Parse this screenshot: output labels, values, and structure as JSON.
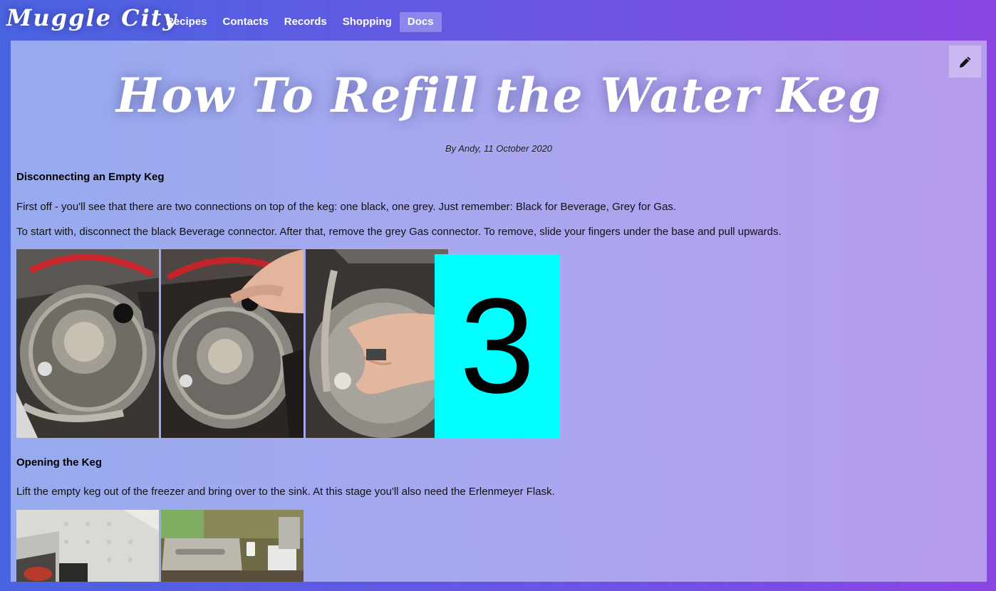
{
  "app": {
    "brand": "Muggle City"
  },
  "nav": {
    "items": [
      {
        "label": "Recipes"
      },
      {
        "label": "Contacts"
      },
      {
        "label": "Records"
      },
      {
        "label": "Shopping"
      },
      {
        "label": "Docs",
        "active": true
      }
    ]
  },
  "toolbar": {
    "edit_icon": "pencil-icon"
  },
  "article": {
    "title": "How To Refill the Water Keg",
    "byline": "By Andy, 11 October 2020",
    "sections": [
      {
        "heading": "Disconnecting an Empty Keg",
        "paragraphs": [
          "First off - you'll see that there are two connections on top of the keg: one black, one grey. Just remember: Black for Beverage, Grey for Gas.",
          "To start with, disconnect the black Beverage connector. After that, remove the grey Gas connector. To remove, slide your fingers under the base and pull upwards."
        ],
        "photos": [
          "keg-top-photo",
          "keg-disconnect-photo",
          "keg-lift-photo"
        ],
        "overlay_number": "3"
      },
      {
        "heading": "Opening the Keg",
        "paragraphs": [
          "Lift the empty keg out of the freezer and bring over to the sink. At this stage you'll also need the Erlenmeyer Flask."
        ],
        "photos": [
          "freezer-photo",
          "sink-keg-photo"
        ]
      }
    ]
  },
  "colors": {
    "header_gradient_start": "#4a63e0",
    "header_gradient_end": "#8a45e3",
    "content_gradient_start": "#97aaee",
    "content_gradient_end": "#b89cee",
    "overlay_cyan": "#00ffff"
  }
}
